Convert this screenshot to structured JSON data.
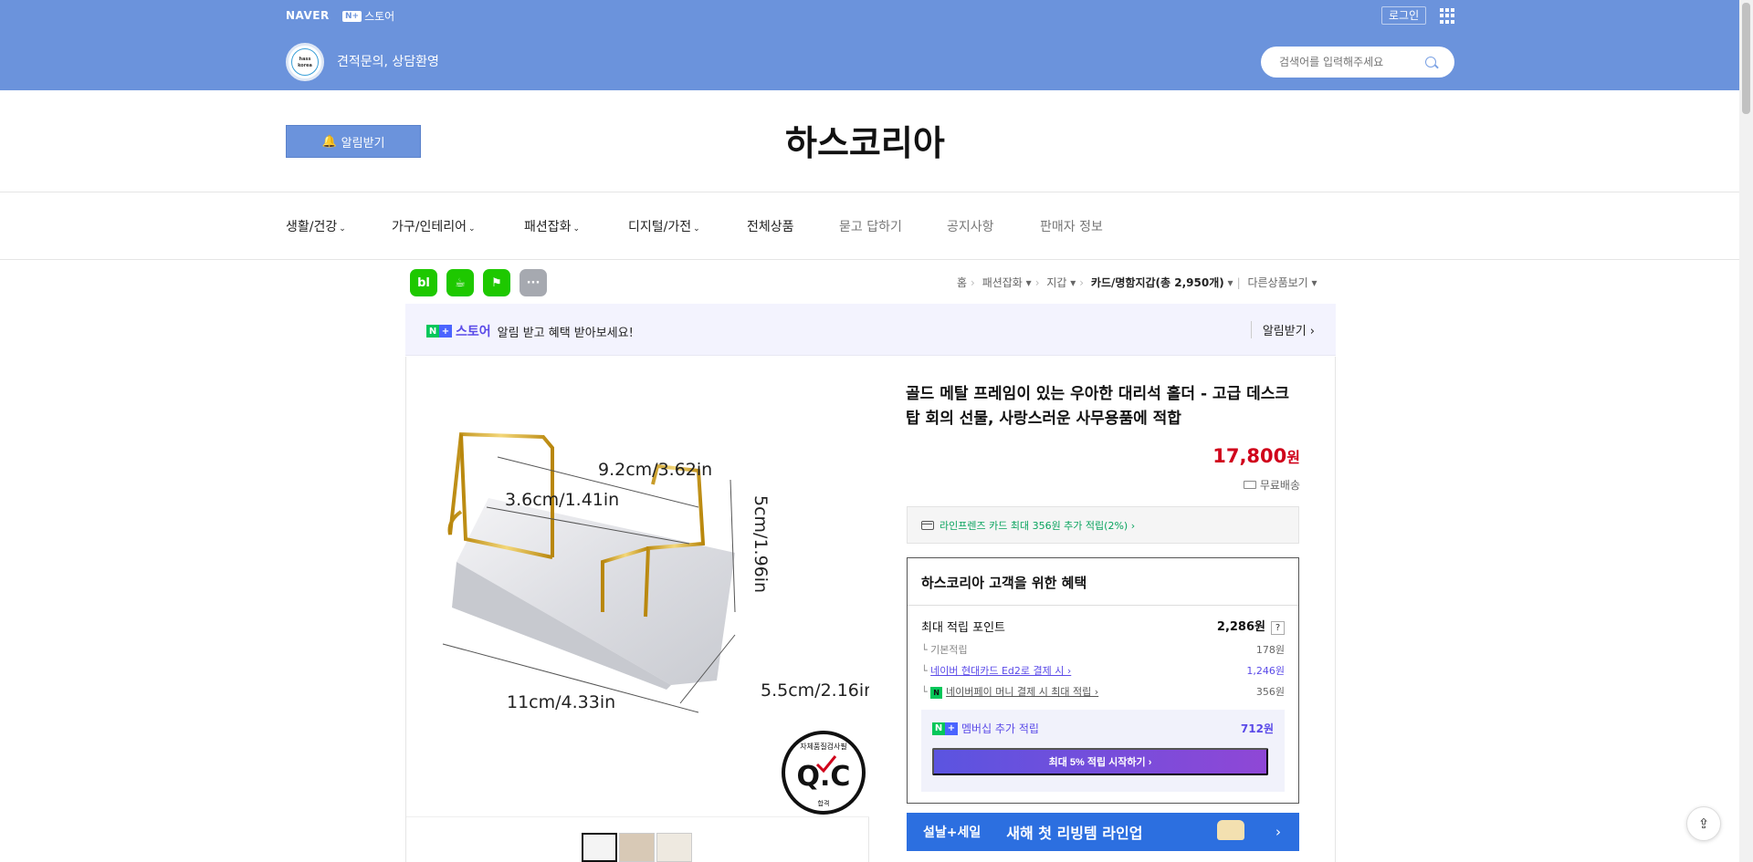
{
  "header": {
    "naver": "NAVER",
    "nstore_badge": "N+",
    "nstore_label": "스토어",
    "login": "로그인",
    "logo_text_1": "hass",
    "logo_text_2": "korea",
    "slogan": "견적문의, 상담환영",
    "search_placeholder": "검색어를 입력해주세요"
  },
  "store": {
    "alarm_button": "알림받기",
    "title": "하스코리아"
  },
  "nav": [
    {
      "label": "생활/건강",
      "dropdown": true
    },
    {
      "label": "가구/인테리어",
      "dropdown": true
    },
    {
      "label": "패션잡화",
      "dropdown": true
    },
    {
      "label": "디지털/가전",
      "dropdown": true
    },
    {
      "label": "전체상품",
      "dropdown": false
    },
    {
      "label": "묻고 답하기",
      "dropdown": false
    },
    {
      "label": "공지사항",
      "dropdown": false
    },
    {
      "label": "판매자 정보",
      "dropdown": false
    }
  ],
  "share": [
    "bl",
    "☕",
    "⚑",
    "···"
  ],
  "breadcrumb": {
    "home": "홈",
    "c1": "패션잡화",
    "c2": "지갑",
    "c3": "카드/명함지갑(총 2,950개)",
    "other": "다른상품보기"
  },
  "banner": {
    "store_word": "스토어",
    "text": "알림 받고 혜택 받아보세요!",
    "alarm": "알림받기 ›"
  },
  "product": {
    "title": "골드 메탈 프레임이 있는 우아한 대리석 홀더 - 고급 데스크탑 회의 선물, 사랑스러운 사무용품에 적합",
    "price": "17,800",
    "currency": "원",
    "shipping": "무료배송",
    "card_benefit": "라인프렌즈 카드 최대 356원 추가 적립(2%) ›",
    "image_labels": {
      "w": "9.2cm/3.62in",
      "d": "3.6cm/1.41in",
      "h": "5cm/1.96in",
      "l": "11cm/4.33in",
      "b": "5.5cm/2.16in",
      "qc_top": "자체품질검사필",
      "qc": "Q.C",
      "qc_bottom": "합격"
    }
  },
  "benefit": {
    "title": "하스코리아 고객을 위한 혜택",
    "max_label": "최대 적립 포인트",
    "max_value": "2,286원",
    "q": "?",
    "rows": [
      {
        "label": "기본적립",
        "value": "178원"
      },
      {
        "label": "네이버 현대카드 Ed2로 결제 시 ›",
        "value": "1,246원"
      },
      {
        "label": "네이버페이 머니 결제 시 최대 적립 ›",
        "value": "356원"
      }
    ],
    "membership_label": "멤버십 추가 적립",
    "membership_value": "712원",
    "membership_button": "최대 5% 적립 시작하기 ›"
  },
  "promo": {
    "tag": "설날+세일",
    "text": "새해 첫 리빙템 라인업",
    "arrow": "›"
  },
  "colors": {
    "header": "#6b93dc",
    "price": "#d0021b",
    "naver_green": "#03c75a",
    "accent_purple": "#5a4ae8"
  }
}
